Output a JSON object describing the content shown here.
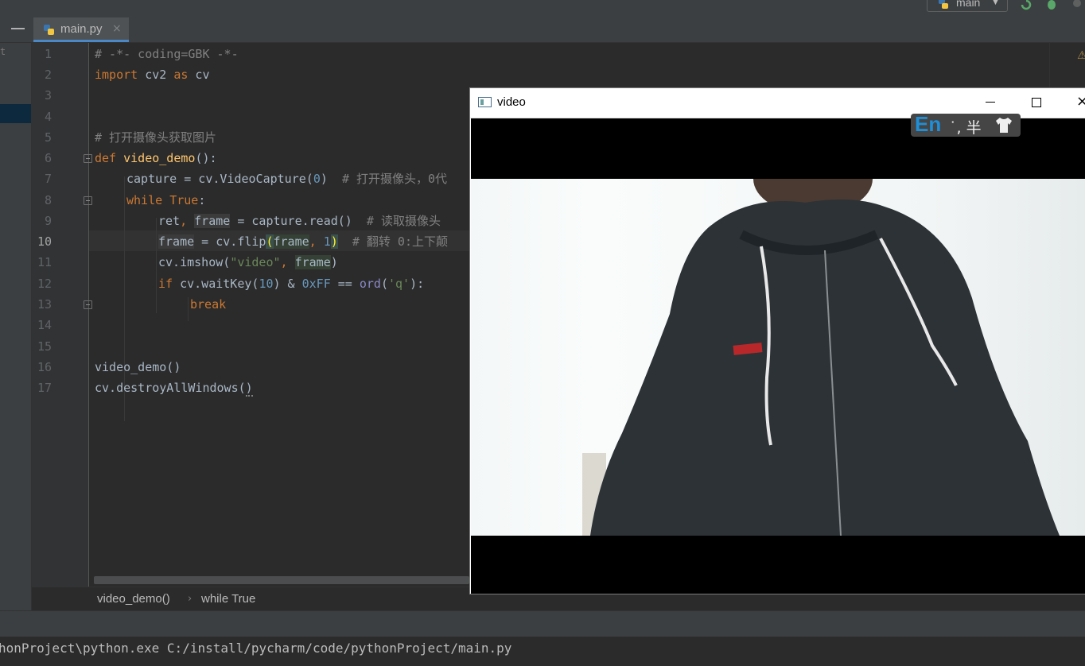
{
  "toolbar": {
    "branch": "main"
  },
  "tab": {
    "filename": "main.py",
    "close": "×"
  },
  "project_strip": {
    "truncated_text": "t"
  },
  "editor": {
    "current_line": 10,
    "line_numbers": [
      "1",
      "2",
      "3",
      "4",
      "5",
      "6",
      "7",
      "8",
      "9",
      "10",
      "11",
      "12",
      "13",
      "14",
      "15",
      "16",
      "17"
    ],
    "code": {
      "l1": "# -*- coding=GBK -*-",
      "l2_kw1": "import",
      "l2_mid": " cv2 ",
      "l2_kw2": "as",
      "l2_end": " cv",
      "l5": "# 打开摄像头获取图片",
      "l6_kw": "def",
      "l6_fn": "video_demo",
      "l6_end": "():",
      "l7_a": "capture = cv.VideoCapture(",
      "l7_num": "0",
      "l7_b": ")  ",
      "l7_cm": "# 打开摄像头，0代",
      "l8_kw": "while",
      "l8_kw2": "True",
      "l8_end": ":",
      "l9_a": "ret",
      "l9_b": ", ",
      "l9_var": "frame",
      "l9_c": " = capture.read()  ",
      "l9_cm": "# 读取摄像头",
      "l10_var": "frame",
      "l10_a": " = cv.flip",
      "l10_p1": "(",
      "l10_arg": "frame",
      "l10_b": ", ",
      "l10_num": "1",
      "l10_p2": ")",
      "l10_c": "  ",
      "l10_cm": "# 翻转 0:上下颠",
      "l11_a": "cv.imshow(",
      "l11_str": "\"video\"",
      "l11_b": ", ",
      "l11_var": "frame",
      "l11_c": ")",
      "l12_kw": "if",
      "l12_a": " cv.waitKey(",
      "l12_num": "10",
      "l12_b": ") & ",
      "l12_hex": "0xFF",
      "l12_c": " == ",
      "l12_ord": "ord",
      "l12_d": "(",
      "l12_str": "'q'",
      "l12_e": "):",
      "l13_kw": "break",
      "l16": "video_demo()",
      "l17_a": "cv.destroyAllWindows(",
      "l17_b": ")"
    },
    "warning_icon": "⚠"
  },
  "breadcrumb": {
    "items": [
      "video_demo()",
      "while True"
    ],
    "separator": "›"
  },
  "run": {
    "command": "honProject\\python.exe C:/install/pycharm/code/pythonProject/main.py"
  },
  "video_window": {
    "title": "video",
    "minimize": "minimize-icon",
    "maximize": "maximize-icon",
    "close": "×",
    "content": "webcam frame of person in dark hooded jacket with white drawstrings"
  },
  "ime": {
    "mode": "En",
    "rest": "˙, 半"
  },
  "colors": {
    "accent": "#4a88c7",
    "keyword": "#cc7832",
    "function": "#ffc66d",
    "number": "#6897bb",
    "string": "#6a8759",
    "comment": "#808080",
    "ime_en": "#1e8fd8"
  }
}
